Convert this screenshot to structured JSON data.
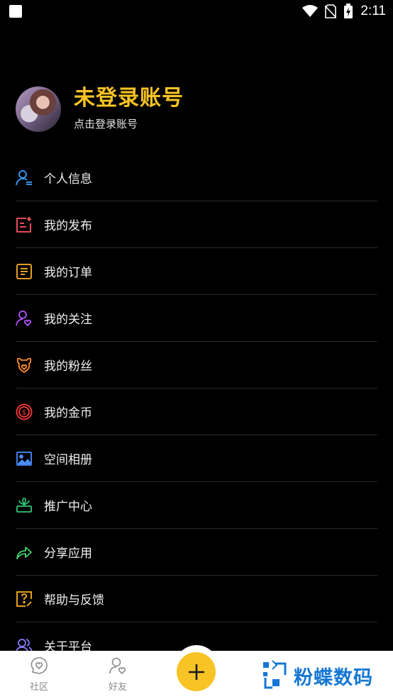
{
  "status_bar": {
    "time": "2:11"
  },
  "profile": {
    "name": "未登录账号",
    "subtitle": "点击登录账号"
  },
  "menu": {
    "items": [
      {
        "label": "个人信息",
        "icon": "user-list-icon",
        "color": "#3aa0ff"
      },
      {
        "label": "我的发布",
        "icon": "publish-icon",
        "color": "#ff5566"
      },
      {
        "label": "我的订单",
        "icon": "order-icon",
        "color": "#ffb020"
      },
      {
        "label": "我的关注",
        "icon": "follow-icon",
        "color": "#b455ff"
      },
      {
        "label": "我的粉丝",
        "icon": "fans-icon",
        "color": "#ff8a2a"
      },
      {
        "label": "我的金币",
        "icon": "coin-icon",
        "color": "#ff3b3b"
      },
      {
        "label": "空间相册",
        "icon": "album-icon",
        "color": "#4a8cff"
      },
      {
        "label": "推广中心",
        "icon": "promotion-icon",
        "color": "#2fc47a"
      },
      {
        "label": "分享应用",
        "icon": "share-icon",
        "color": "#47d06b"
      },
      {
        "label": "帮助与反馈",
        "icon": "help-feedback-icon",
        "color": "#ffb020"
      },
      {
        "label": "关于平台",
        "icon": "about-icon",
        "color": "#8a7dff"
      }
    ]
  },
  "bottom_nav": {
    "community": "社区",
    "friends": "好友"
  },
  "watermark": {
    "text": "粉蝶数码"
  },
  "colors": {
    "accent": "#f7c325",
    "background": "#000000",
    "watermark": "#1577d3"
  }
}
